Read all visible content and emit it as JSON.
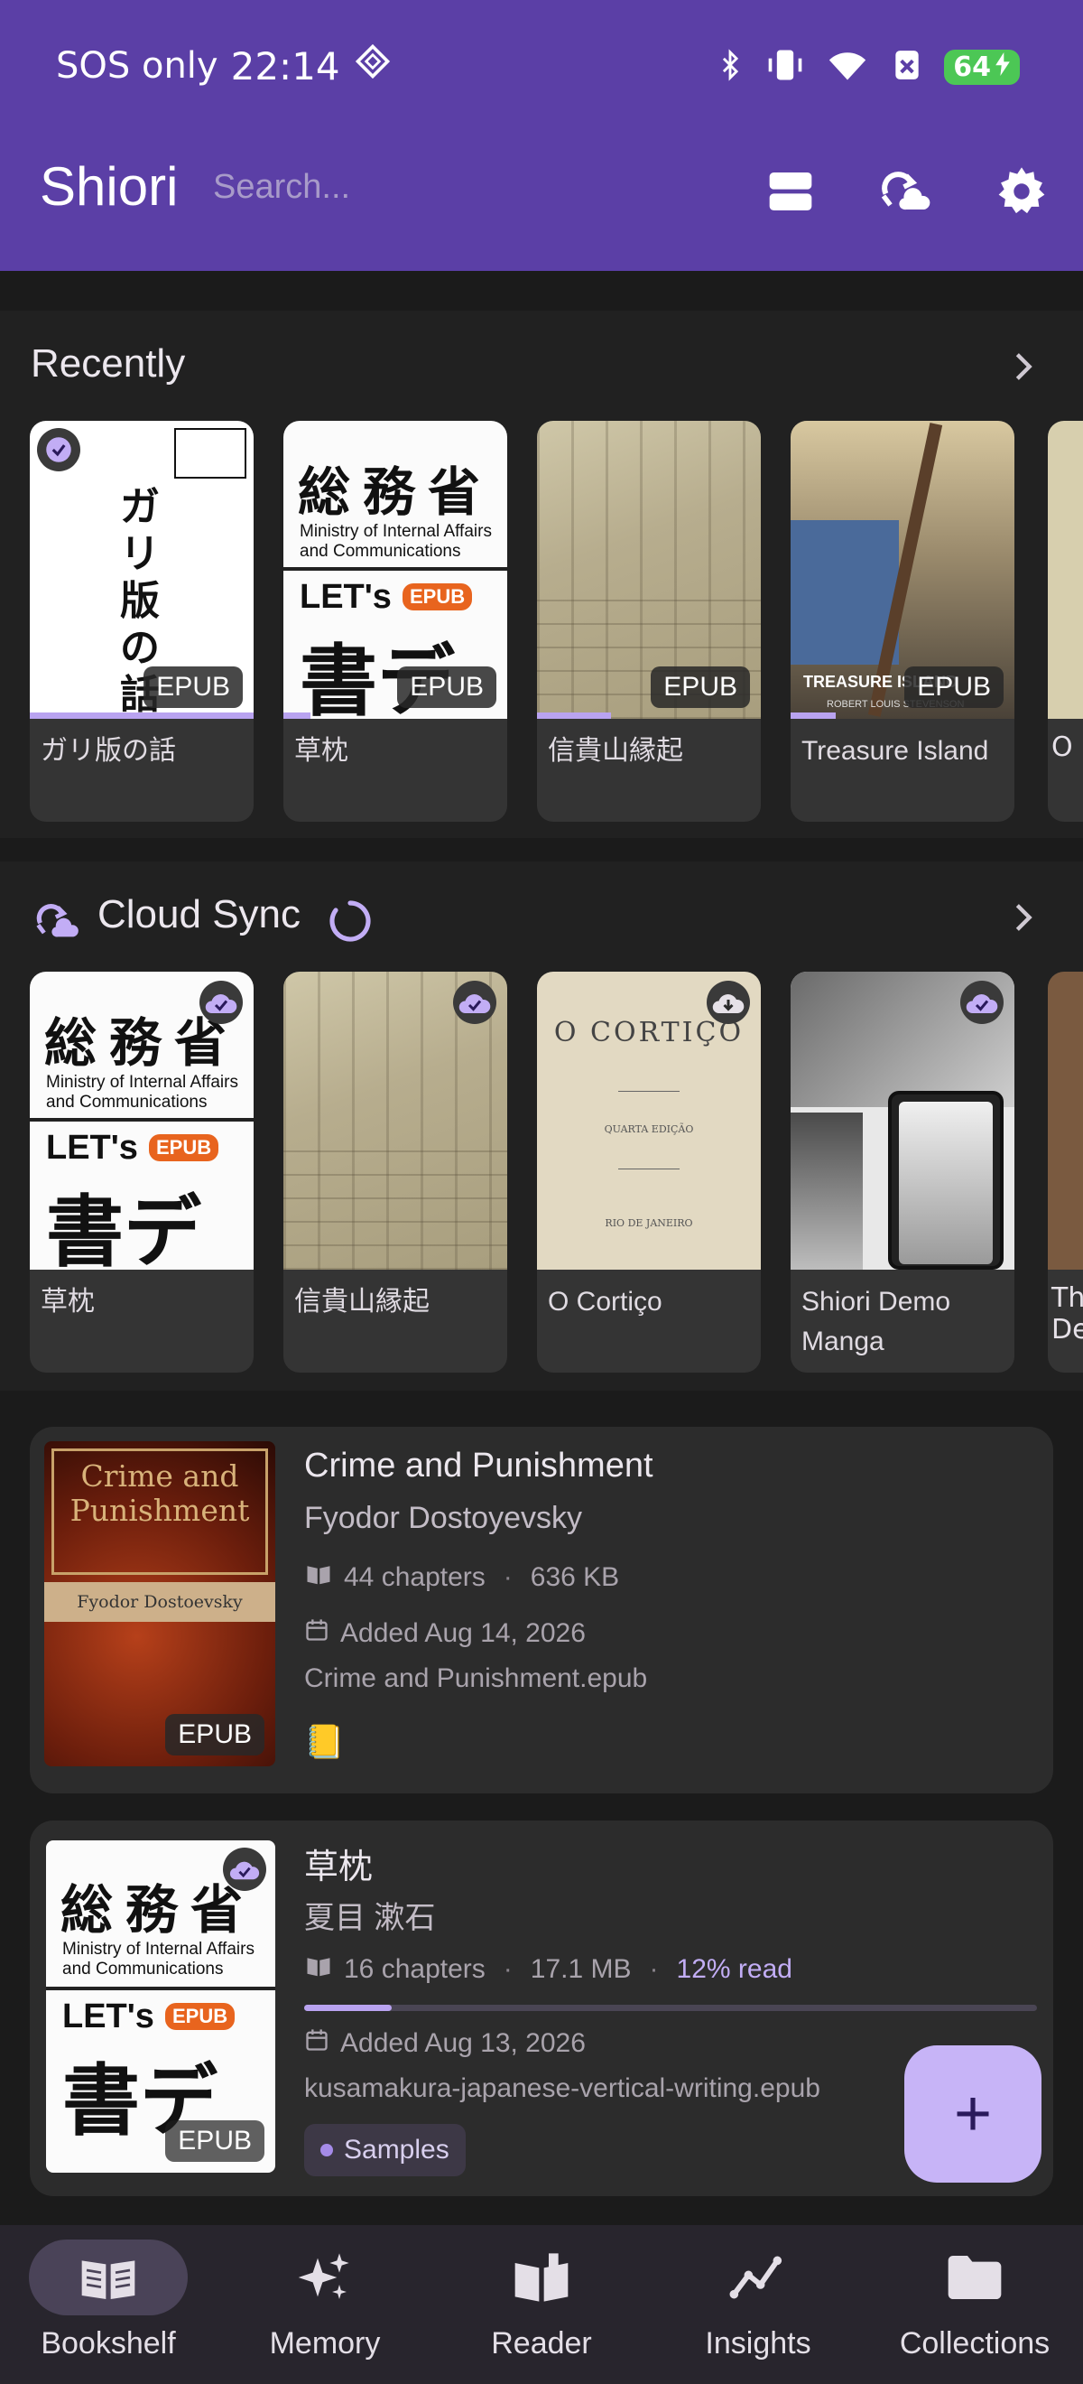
{
  "status_bar": {
    "carrier": "SOS only",
    "time": "22:14",
    "battery": "64"
  },
  "header": {
    "app_title": "Shiori",
    "search_placeholder": "Search..."
  },
  "recently": {
    "title": "Recently",
    "items": [
      {
        "title": "ガリ版の話",
        "badge": "EPUB",
        "progress": 1.0,
        "checked": true
      },
      {
        "title": "草枕",
        "badge": "EPUB",
        "progress": 0.12
      },
      {
        "title": "信貴山縁起",
        "badge": "EPUB",
        "progress": 0.33
      },
      {
        "title": "Treasure Island",
        "badge": "EPUB",
        "progress": 0.2,
        "cover_title": "TREASURE ISLAND",
        "cover_author": "ROBERT LOUIS STEVENSON"
      },
      {
        "title": "O"
      }
    ]
  },
  "cloud_sync": {
    "title": "Cloud Sync",
    "items": [
      {
        "title": "草枕",
        "status": "synced"
      },
      {
        "title": "信貴山縁起",
        "status": "synced"
      },
      {
        "title": "O Cortiço",
        "status": "download",
        "cover_title": "O CORTIÇO",
        "cover_sub": "QUARTA EDIÇÃO",
        "cover_pub": "RIO DE JANEIRO"
      },
      {
        "title": "Shiori Demo Manga",
        "status": "synced"
      },
      {
        "title": "Th De"
      }
    ]
  },
  "cover_text": {
    "kanji": "総務省",
    "ministry": "Ministry of Internal Affairs and Communications",
    "lets": "LET's",
    "epub_tag": "EPUB",
    "shodeji": "書デジ",
    "gari": "ガリ版の話",
    "crime_title": "Crime and Punishment",
    "crime_author": "Fyodor Dostoevsky"
  },
  "library": [
    {
      "title": "Crime and Punishment",
      "author": "Fyodor Dostoyevsky",
      "chapters": "44 chapters",
      "size": "636 KB",
      "added": "Added Aug 14, 2026",
      "file": "Crime and Punishment.epub",
      "badge": "EPUB",
      "emoji": "📒"
    },
    {
      "title": "草枕",
      "author": "夏目 漱石",
      "chapters": "16 chapters",
      "size": "17.1 MB",
      "read": "12% read",
      "read_fraction": 0.12,
      "added": "Added Aug 13, 2026",
      "file": "kusamakura-japanese-vertical-writing.epub",
      "badge": "EPUB",
      "collection": "Samples"
    }
  ],
  "fab": {
    "label": "+"
  },
  "nav": [
    {
      "label": "Bookshelf",
      "icon": "book-open-icon",
      "active": true
    },
    {
      "label": "Memory",
      "icon": "sparkles-icon"
    },
    {
      "label": "Reader",
      "icon": "reader-book-icon"
    },
    {
      "label": "Insights",
      "icon": "insights-chart-icon"
    },
    {
      "label": "Collections",
      "icon": "folder-icon"
    }
  ],
  "colors": {
    "header": "#5b3fa6",
    "accent": "#b9a3f0",
    "fab": "#c7b4f7",
    "card": "#343434"
  }
}
